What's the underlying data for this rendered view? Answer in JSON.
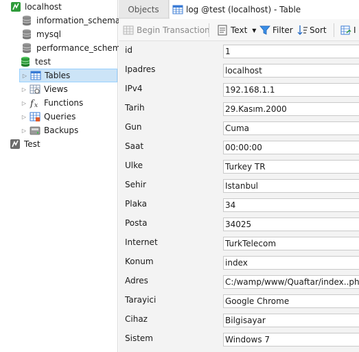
{
  "sidebar": {
    "items": [
      {
        "label": "localhost",
        "icon": "server-connected-icon"
      },
      {
        "label": "information_schema",
        "icon": "database-icon"
      },
      {
        "label": "mysql",
        "icon": "database-icon"
      },
      {
        "label": "performance_schema",
        "icon": "database-icon"
      },
      {
        "label": "test",
        "icon": "database-open-icon"
      },
      {
        "label": "Tables",
        "icon": "table-icon"
      },
      {
        "label": "Views",
        "icon": "view-icon"
      },
      {
        "label": "Functions",
        "icon": "function-icon"
      },
      {
        "label": "Queries",
        "icon": "query-icon"
      },
      {
        "label": "Backups",
        "icon": "backup-icon"
      },
      {
        "label": "Test",
        "icon": "server-disconnected-icon"
      }
    ]
  },
  "tabs": {
    "objects": "Objects",
    "log": "log @test (localhost) - Table"
  },
  "toolbar": {
    "begin_transaction": "Begin Transaction",
    "text": "Text",
    "filter": "Filter",
    "sort": "Sort",
    "import_partial": "I"
  },
  "form": {
    "fields": [
      {
        "label": "id",
        "value": "1"
      },
      {
        "label": "Ipadres",
        "value": "localhost"
      },
      {
        "label": "IPv4",
        "value": "192.168.1.1"
      },
      {
        "label": "Tarih",
        "value": "29.Kasım.2000"
      },
      {
        "label": "Gun",
        "value": "Cuma"
      },
      {
        "label": "Saat",
        "value": "00:00:00"
      },
      {
        "label": "Ulke",
        "value": "Turkey TR"
      },
      {
        "label": "Sehir",
        "value": "Istanbul"
      },
      {
        "label": "Plaka",
        "value": "34"
      },
      {
        "label": "Posta",
        "value": "34025"
      },
      {
        "label": "Internet",
        "value": "TurkTelecom"
      },
      {
        "label": "Konum",
        "value": "index"
      },
      {
        "label": "Adres",
        "value": "C:/wamp/www/Quaftar/index..php"
      },
      {
        "label": "Tarayici",
        "value": "Google Chrome"
      },
      {
        "label": "Cihaz",
        "value": "Bilgisayar"
      },
      {
        "label": "Sistem",
        "value": "Windows 7"
      }
    ]
  },
  "colors": {
    "selection": "#cce4f7",
    "accent_green": "#2e9b3a",
    "db_gray": "#8a8a8a",
    "link_blue": "#2b7bd6"
  }
}
